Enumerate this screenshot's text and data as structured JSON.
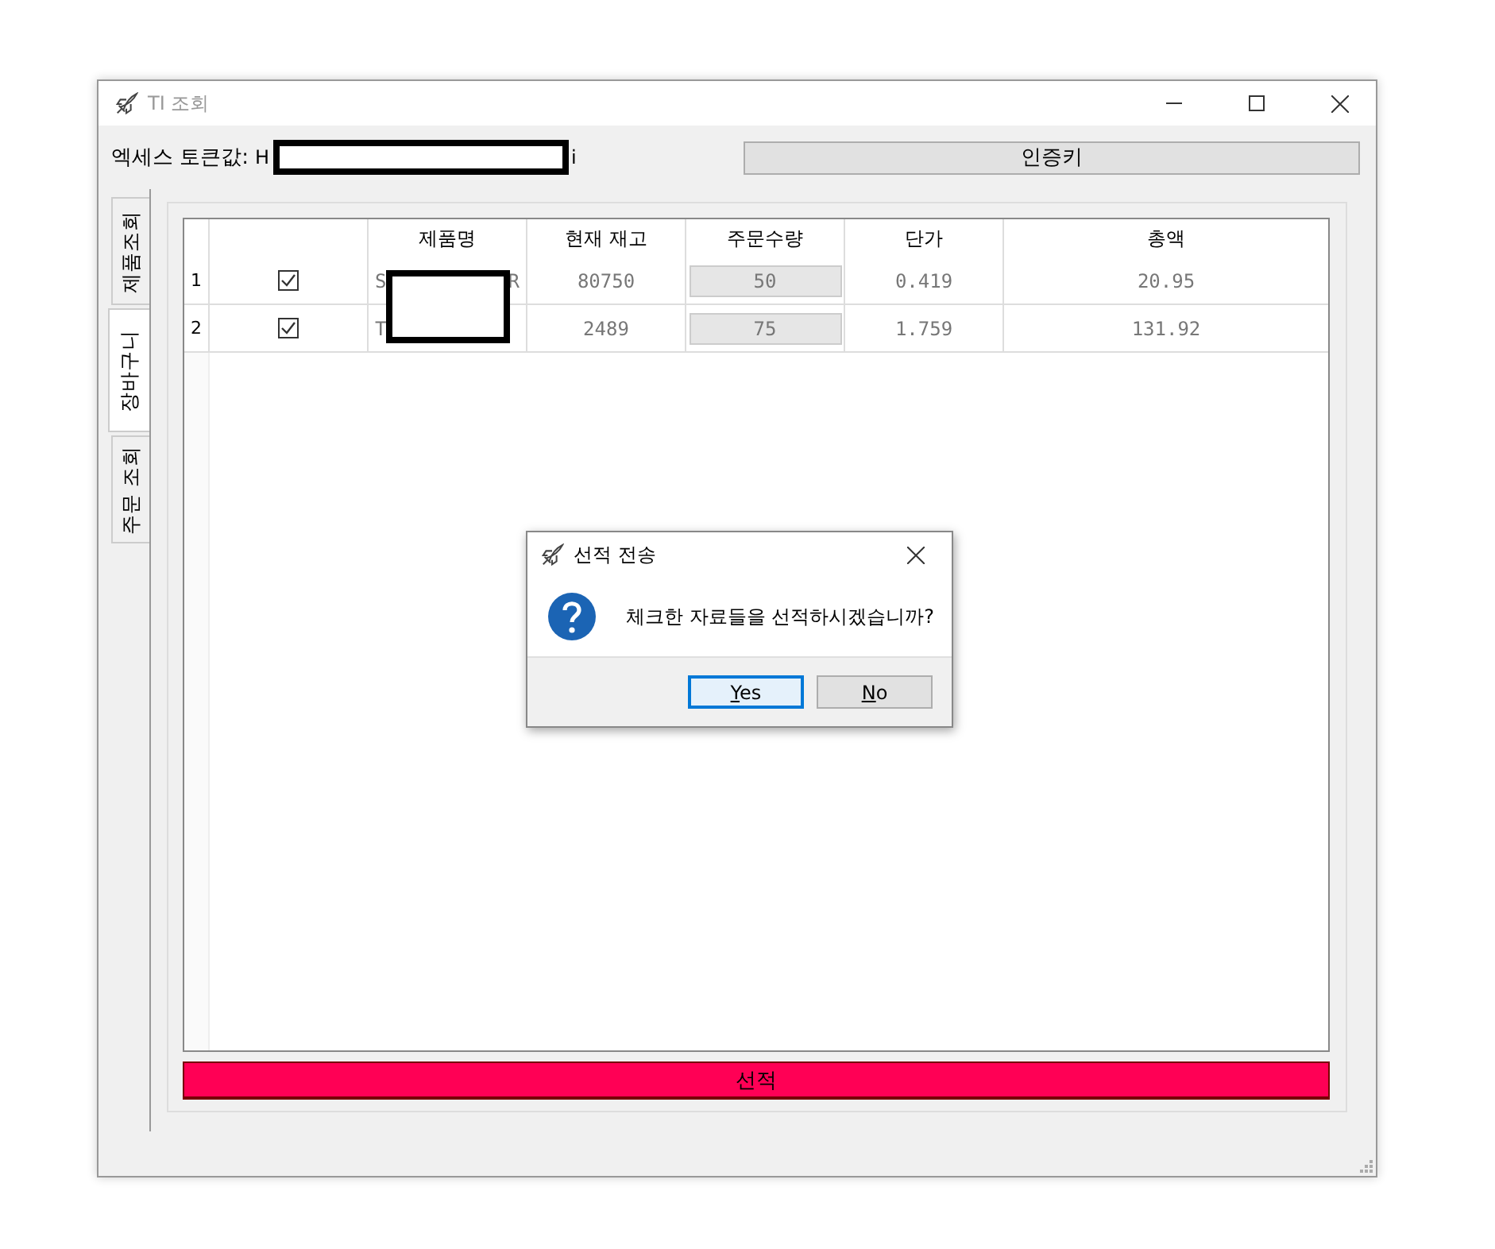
{
  "window": {
    "title": "TI 조회"
  },
  "token": {
    "label": "엑세스 토큰값:",
    "value_start": "H",
    "value_end": "i"
  },
  "auth_button": "인증키",
  "tabs": [
    {
      "label": "제품조회",
      "selected": false
    },
    {
      "label": "장바구니",
      "selected": true
    },
    {
      "label": "주문 조회",
      "selected": false
    }
  ],
  "table": {
    "columns": [
      "제품명",
      "현재 재고",
      "주문수량",
      "단가",
      "총액"
    ],
    "rows": [
      {
        "index": "1",
        "checked": true,
        "name_start": "S",
        "name_end": "R",
        "stock": "80750",
        "qty": "50",
        "price": "0.419",
        "total": "20.95"
      },
      {
        "index": "2",
        "checked": true,
        "name_start": "T",
        "stock": "2489",
        "qty": "75",
        "price": "1.759",
        "total": "131.92"
      }
    ]
  },
  "ship_button": "선적",
  "dialog": {
    "title": "선적 전송",
    "message": "체크한 자료들을 선적하시겠습니까?",
    "buttons": [
      {
        "label": "Yes",
        "selected": true
      },
      {
        "label": "No",
        "selected": false
      }
    ]
  }
}
